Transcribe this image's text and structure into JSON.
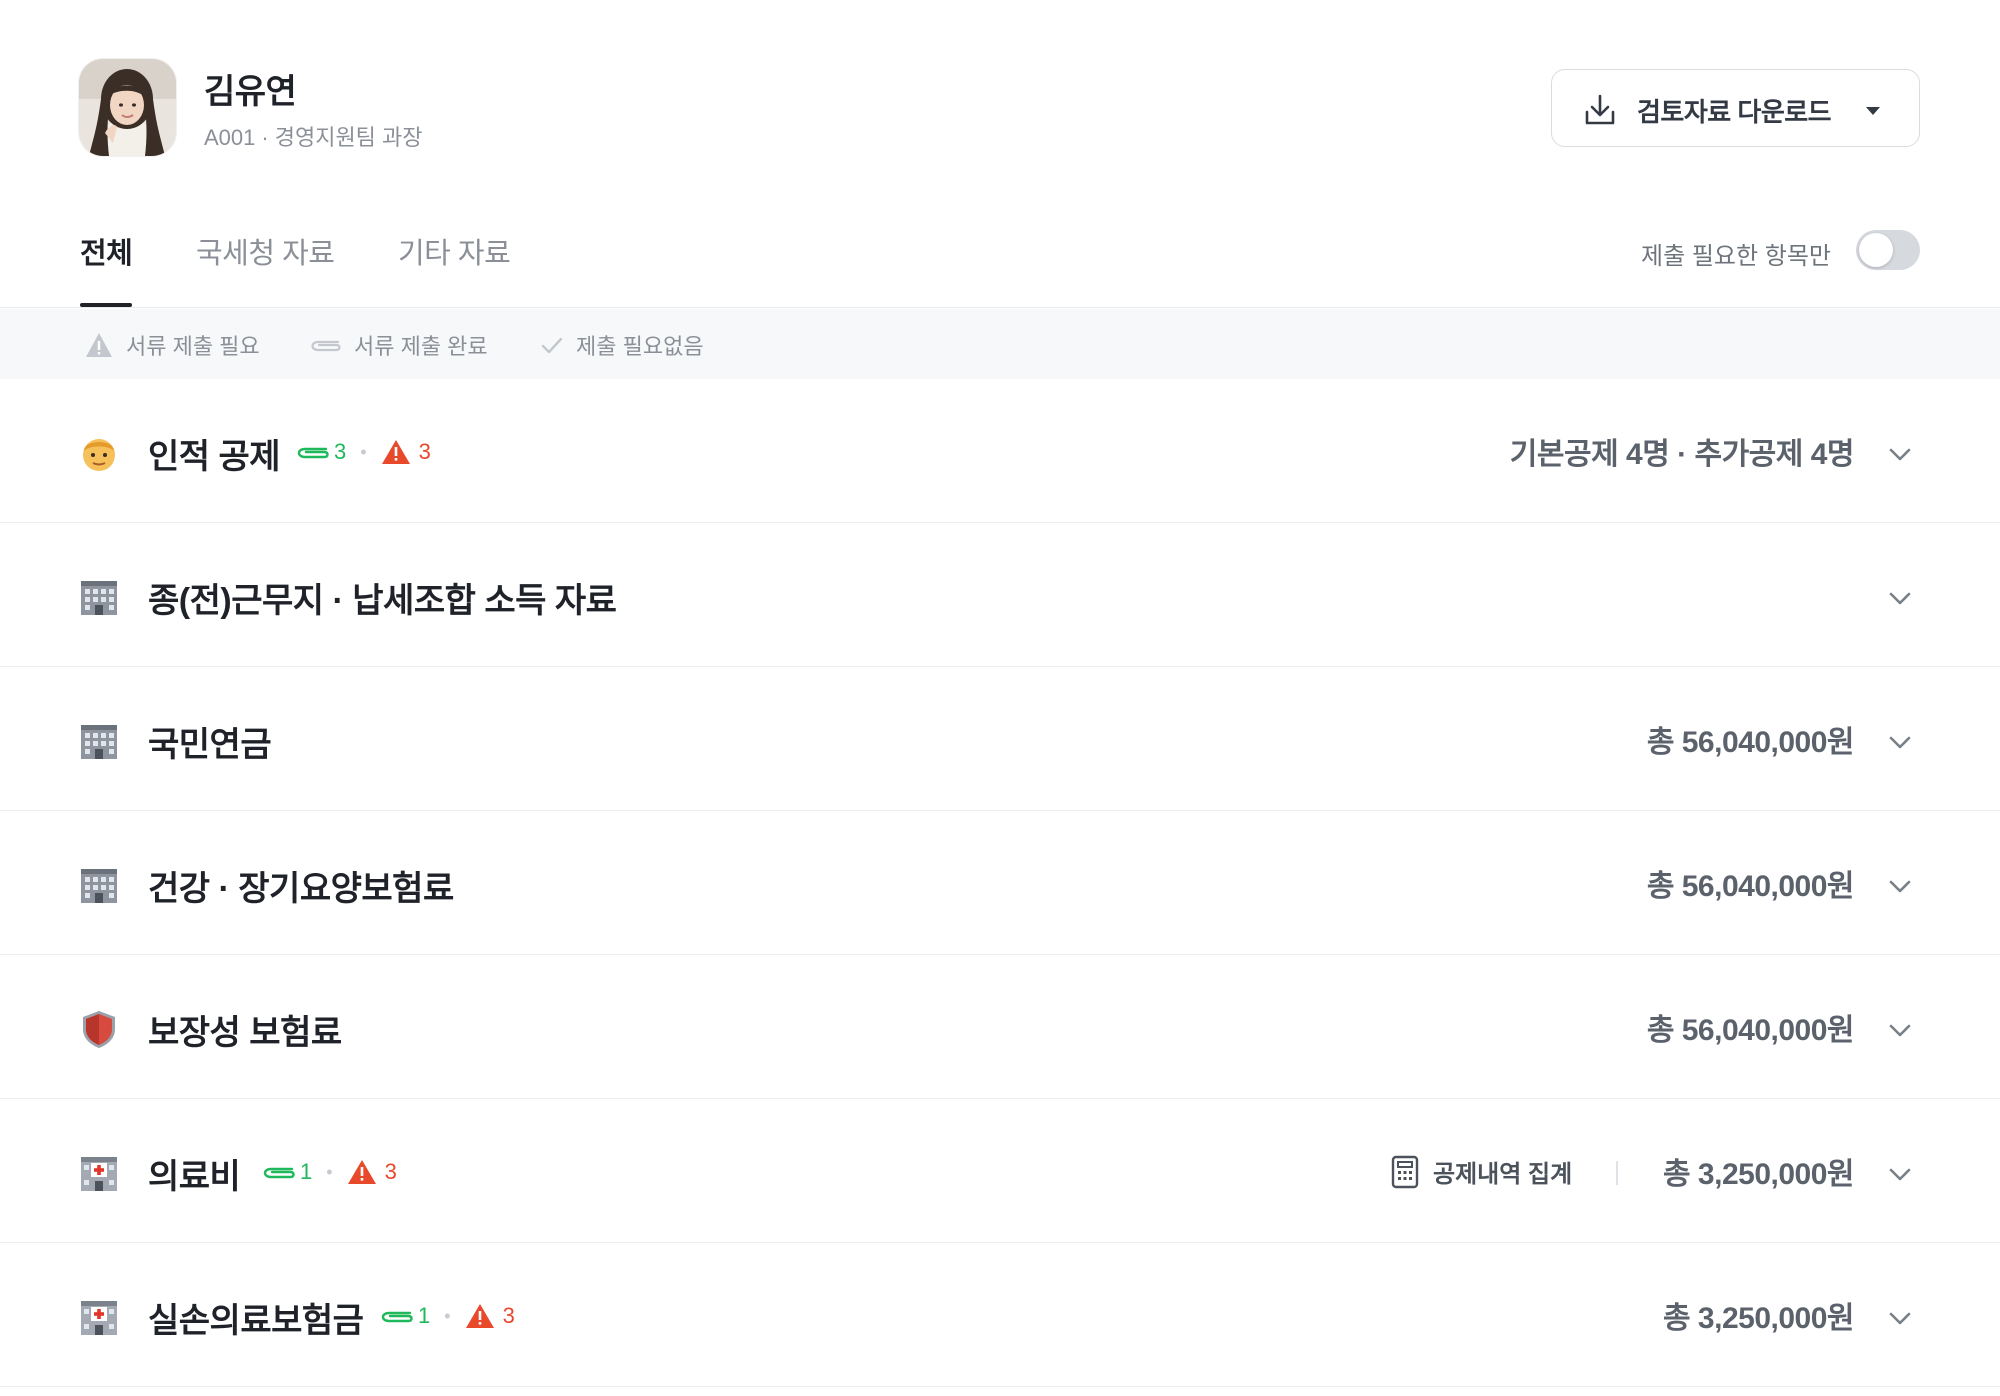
{
  "user": {
    "name": "김유연",
    "employee_id": "A001",
    "separator": "·",
    "department_title": "경영지원팀 과장"
  },
  "download": {
    "label": "검토자료 다운로드",
    "icon": "download-icon"
  },
  "tabs": [
    {
      "label": "전체",
      "active": true
    },
    {
      "label": "국세청 자료",
      "active": false
    },
    {
      "label": "기타 자료",
      "active": false
    }
  ],
  "filter_toggle": {
    "label": "제출 필요한 항목만",
    "on": false
  },
  "legend": [
    {
      "label": "서류 제출 필요",
      "icon": "warning-icon"
    },
    {
      "label": "서류 제출 완료",
      "icon": "paperclip-icon"
    },
    {
      "label": "제출 필요없음",
      "icon": "check-icon"
    }
  ],
  "rows": [
    {
      "icon": "person-emoji-icon",
      "title": "인적 공제",
      "attach_count": "3",
      "warn_count": "3",
      "summary": "기본공제 4명 · 추가공제 4명"
    },
    {
      "icon": "office-building-icon",
      "title": "종(전)근무지 · 납세조합 소득 자료",
      "summary": ""
    },
    {
      "icon": "office-building-icon",
      "title": "국민연금",
      "summary": "총 56,040,000원"
    },
    {
      "icon": "office-building-icon",
      "title": "건강 · 장기요양보험료",
      "summary": "총 56,040,000원"
    },
    {
      "icon": "shield-icon",
      "title": "보장성 보험료",
      "summary": "총 56,040,000원"
    },
    {
      "icon": "hospital-icon",
      "title": "의료비",
      "attach_count": "1",
      "warn_count": "3",
      "calc_label": "공제내역 집계",
      "summary": "총 3,250,000원"
    },
    {
      "icon": "hospital-icon",
      "title": "실손의료보험금",
      "attach_count": "1",
      "warn_count": "3",
      "summary": "총 3,250,000원"
    }
  ],
  "colors": {
    "attach_green": "#1fb85a",
    "warn_red": "#e8492b",
    "text_primary": "#1f2329",
    "text_secondary": "#8b9098"
  }
}
